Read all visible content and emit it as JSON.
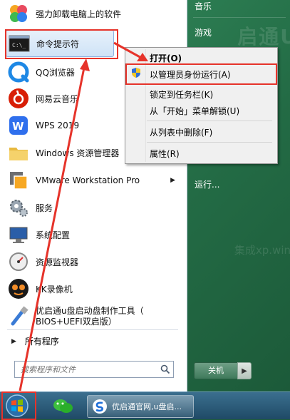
{
  "right_pane": {
    "music": "音乐",
    "games": "游戏",
    "run": "运行...",
    "shutdown": "关机",
    "watermark": "启通U",
    "watermark2": "集成xp.win"
  },
  "left_pane": {
    "items": [
      {
        "label": "强力卸载电脑上的软件",
        "icon": "uninstaller-icon"
      },
      {
        "label": "命令提示符",
        "icon": "cmd-icon"
      },
      {
        "label": "QQ浏览器",
        "icon": "qq-browser-icon"
      },
      {
        "label": "网易云音乐",
        "icon": "netease-music-icon"
      },
      {
        "label": "WPS 2019",
        "icon": "wps-icon"
      },
      {
        "label": "Windows 资源管理器",
        "icon": "folder-icon"
      },
      {
        "label": "VMware Workstation Pro",
        "icon": "vmware-icon"
      },
      {
        "label": "服务",
        "icon": "services-icon"
      },
      {
        "label": "系统配置",
        "icon": "msconfig-icon"
      },
      {
        "label": "资源监视器",
        "icon": "resource-monitor-icon"
      },
      {
        "label": "KK录像机",
        "icon": "kk-recorder-icon"
      },
      {
        "label": "优启通u盘启动盘制作工具（",
        "label2": "BIOS+UEFI双启版）",
        "icon": "usb-tool-icon"
      }
    ],
    "all_programs": "所有程序",
    "search_placeholder": "搜索程序和文件"
  },
  "context_menu": {
    "open": "打开(O)",
    "run_as_admin": "以管理员身份运行(A)",
    "pin_taskbar": "锁定到任务栏(K)",
    "unpin_start": "从「开始」菜单解锁(U)",
    "remove_list": "从列表中删除(F)",
    "properties": "属性(R)"
  },
  "taskbar": {
    "task_label": "优启通官网,u盘启..."
  },
  "colors": {
    "annotation_red": "#e6332a",
    "highlight_border": "#8db2e3"
  }
}
